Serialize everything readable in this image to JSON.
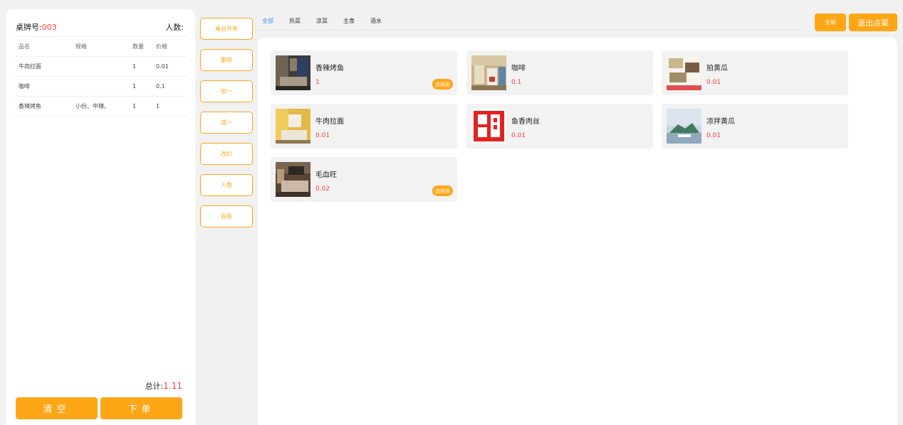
{
  "order": {
    "table_label": "桌牌号:",
    "table_no": "003",
    "people_label": "人数:",
    "headers": [
      "品名",
      "规格",
      "数量",
      "价格"
    ],
    "rows": [
      {
        "name": "牛肉拉面",
        "spec": "",
        "qty": "1",
        "price": "0.01"
      },
      {
        "name": "咖啡",
        "spec": "",
        "qty": "1",
        "price": "0.1"
      },
      {
        "name": "香辣烤鱼",
        "spec": "小份、中辣、",
        "qty": "1",
        "price": "1"
      }
    ],
    "total_label": "总计:",
    "total_value": "1.11",
    "clear_label": "清空",
    "submit_label": "下单"
  },
  "actions": [
    "桌台开单",
    "删除",
    "加一",
    "减一",
    "改价",
    "人数",
    "验券"
  ],
  "tabs": [
    "全部",
    "热菜",
    "凉菜",
    "主食",
    "酒水"
  ],
  "top_buttons": {
    "fullscreen": "全屏",
    "exit": "退出点菜"
  },
  "dishes": [
    {
      "name": "香辣烤鱼",
      "price": "1",
      "spec": "选规格",
      "image": "hotel-room-photo"
    },
    {
      "name": "咖啡",
      "price": "0.1",
      "spec": "",
      "image": "cafe-photo"
    },
    {
      "name": "拍黄瓜",
      "price": "0.01",
      "spec": "",
      "image": "poster-photo"
    },
    {
      "name": "牛肉拉面",
      "price": "0.01",
      "spec": "",
      "image": "yellow-room-photo"
    },
    {
      "name": "鱼香肉丝",
      "price": "0.01",
      "spec": "",
      "image": "red-logo"
    },
    {
      "name": "凉拌黄瓜",
      "price": "0.01",
      "spec": "",
      "image": "island-photo"
    },
    {
      "name": "毛血旺",
      "price": "0.02",
      "spec": "选规格",
      "image": "bedroom-photo"
    }
  ],
  "colors": {
    "accent": "#fda616",
    "price": "#ff3b3b",
    "active_tab": "#3b8fe8"
  }
}
